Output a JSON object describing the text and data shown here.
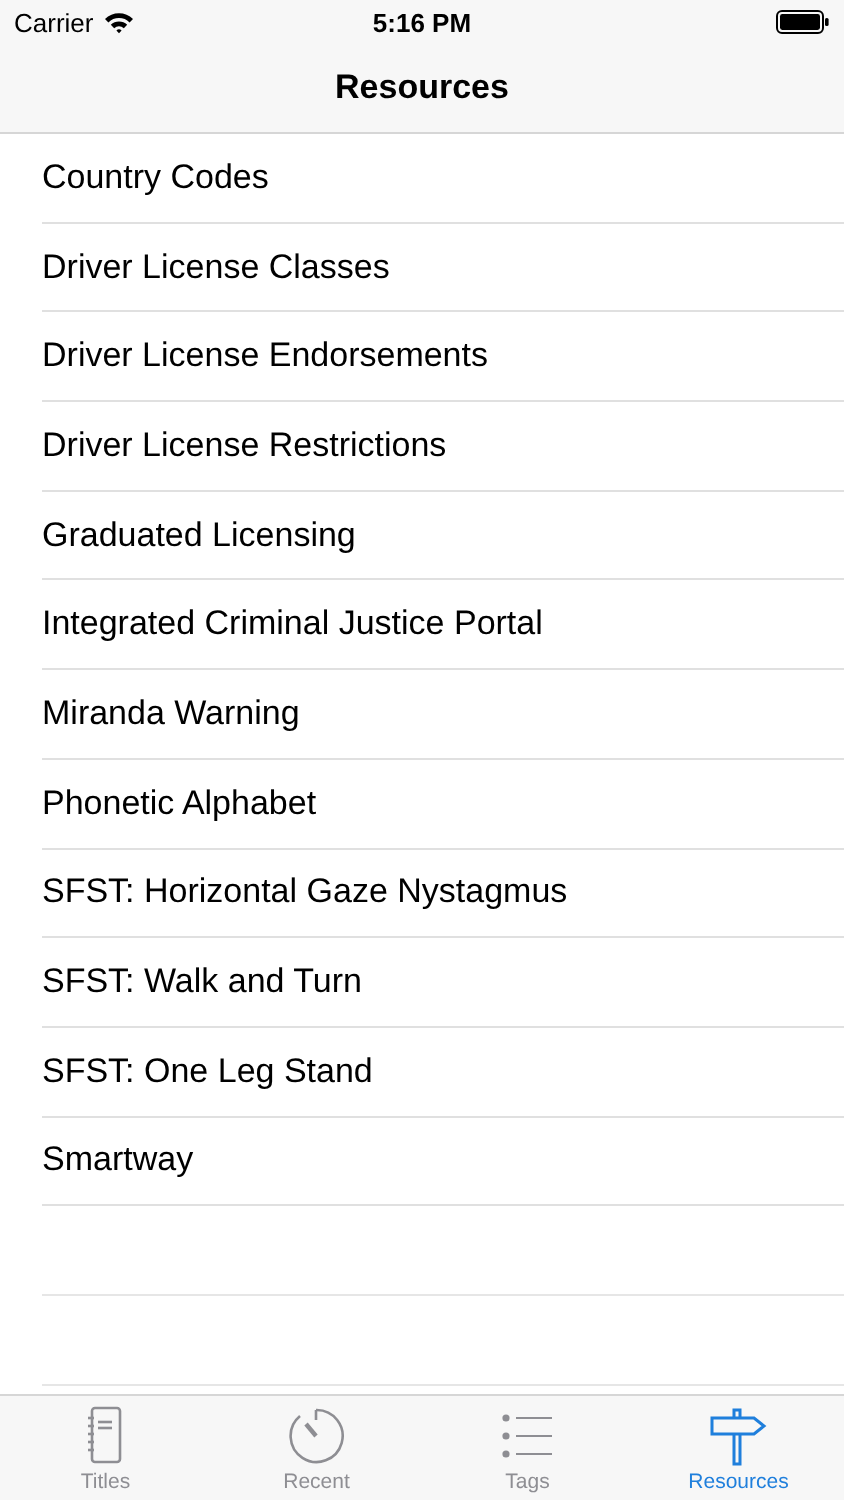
{
  "status_bar": {
    "carrier": "Carrier",
    "time": "5:16 PM"
  },
  "nav_bar": {
    "title": "Resources"
  },
  "items": [
    {
      "label": "Country Codes"
    },
    {
      "label": "Driver License Classes"
    },
    {
      "label": "Driver License Endorsements"
    },
    {
      "label": "Driver License Restrictions"
    },
    {
      "label": "Graduated Licensing"
    },
    {
      "label": "Integrated Criminal Justice Portal"
    },
    {
      "label": "Miranda Warning"
    },
    {
      "label": "Phonetic Alphabet"
    },
    {
      "label": "SFST: Horizontal Gaze Nystagmus"
    },
    {
      "label": "SFST: Walk and Turn"
    },
    {
      "label": "SFST: One Leg Stand"
    },
    {
      "label": "Smartway"
    }
  ],
  "tabs": [
    {
      "label": "Titles",
      "selected": false
    },
    {
      "label": "Recent",
      "selected": false
    },
    {
      "label": "Tags",
      "selected": false
    },
    {
      "label": "Resources",
      "selected": true
    }
  ]
}
